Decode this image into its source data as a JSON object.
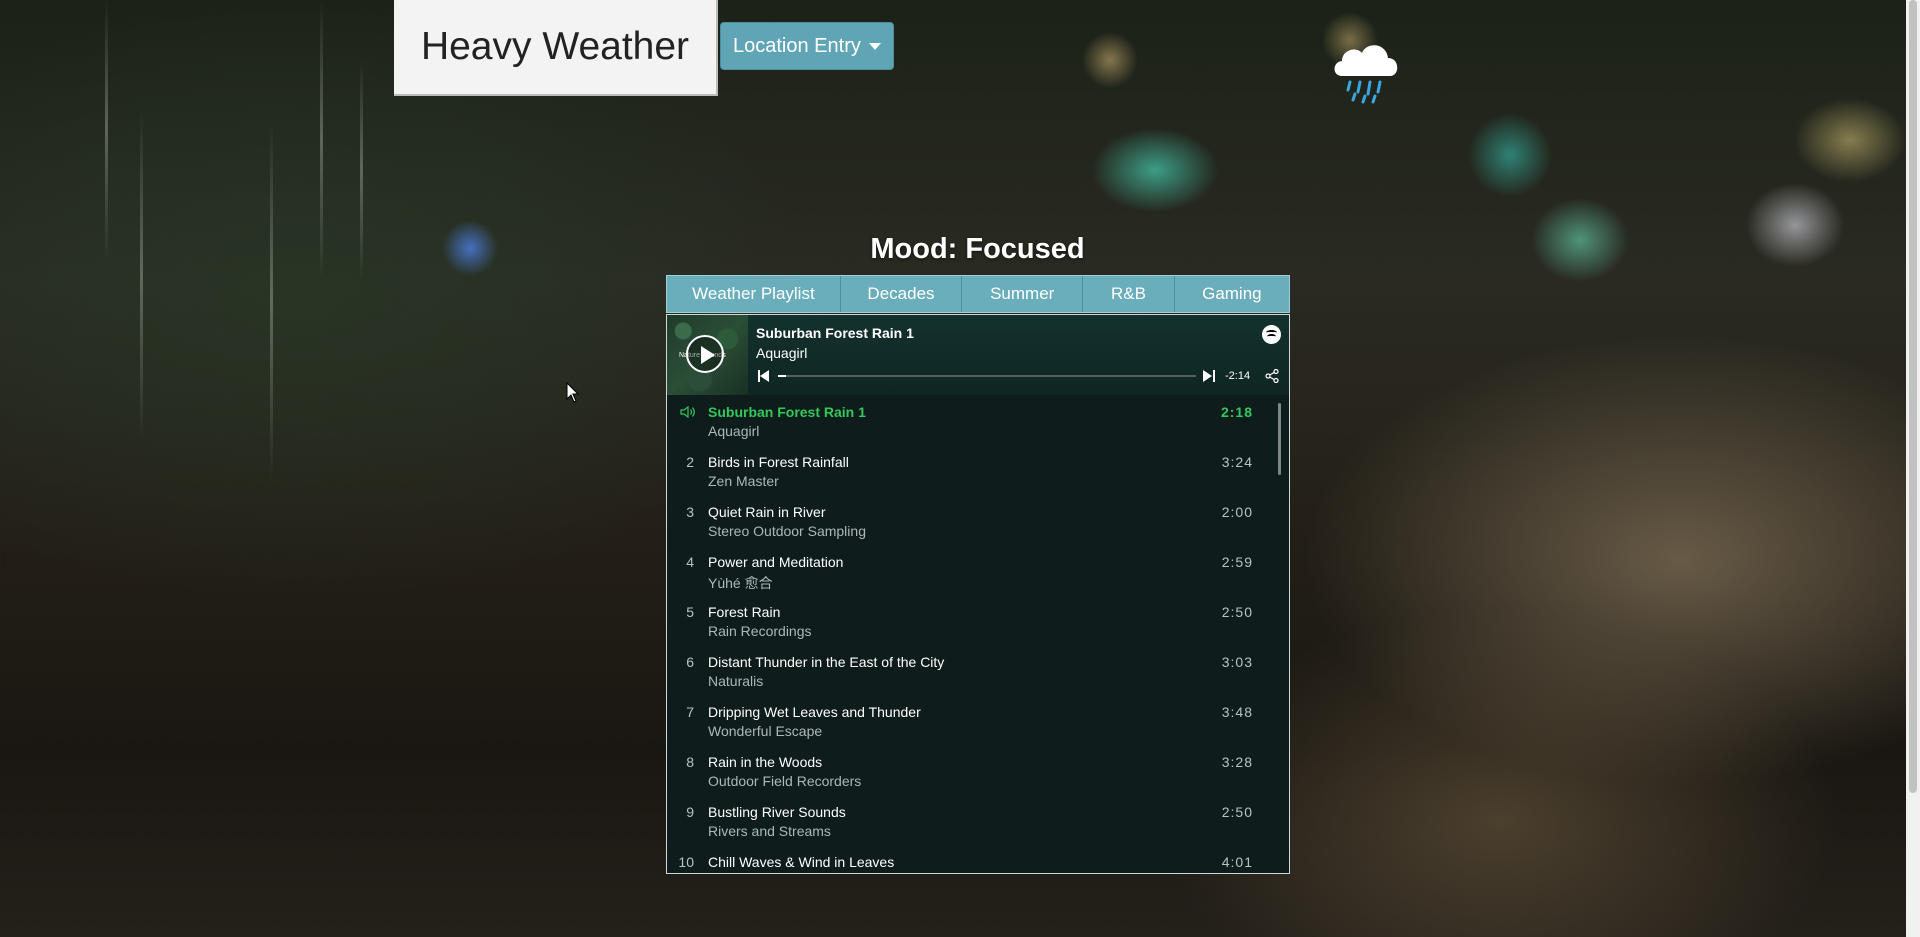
{
  "brand": {
    "title": "Heavy Weather"
  },
  "location_button": {
    "label": "Location Entry"
  },
  "weather_icon": "rain-cloud-icon",
  "mood": {
    "text": "Mood: Focused"
  },
  "tabs": [
    {
      "label": "Weather Playlist"
    },
    {
      "label": "Decades"
    },
    {
      "label": "Summer"
    },
    {
      "label": "R&B"
    },
    {
      "label": "Gaming"
    }
  ],
  "player": {
    "cover_text": "Nature Sounds",
    "now_title": "Suburban Forest Rain 1",
    "now_artist": "Aquagirl",
    "time_remaining": "-2:14",
    "progress_fraction": 0.02,
    "tracks": [
      {
        "num": "",
        "title": "Suburban Forest Rain 1",
        "artist": "Aquagirl",
        "duration": "2:18",
        "active": true
      },
      {
        "num": "2",
        "title": "Birds in Forest Rainfall",
        "artist": "Zen Master",
        "duration": "3:24"
      },
      {
        "num": "3",
        "title": "Quiet Rain in River",
        "artist": "Stereo Outdoor Sampling",
        "duration": "2:00"
      },
      {
        "num": "4",
        "title": "Power and Meditation",
        "artist": "Yùhé 愈合",
        "duration": "2:59"
      },
      {
        "num": "5",
        "title": "Forest Rain",
        "artist": "Rain Recordings",
        "duration": "2:50"
      },
      {
        "num": "6",
        "title": "Distant Thunder in the East of the City",
        "artist": "Naturalis",
        "duration": "3:03"
      },
      {
        "num": "7",
        "title": "Dripping Wet Leaves and Thunder",
        "artist": "Wonderful Escape",
        "duration": "3:48"
      },
      {
        "num": "8",
        "title": "Rain in the Woods",
        "artist": "Outdoor Field Recorders",
        "duration": "3:28"
      },
      {
        "num": "9",
        "title": "Bustling River Sounds",
        "artist": "Rivers and Streams",
        "duration": "2:50"
      },
      {
        "num": "10",
        "title": "Chill Waves & Wind in Leaves",
        "artist": "",
        "duration": "4:01"
      }
    ]
  },
  "colors": {
    "accent_green": "#34c85a",
    "tab_bg": "#6aaebb",
    "button_bg": "#5fa5b5"
  }
}
